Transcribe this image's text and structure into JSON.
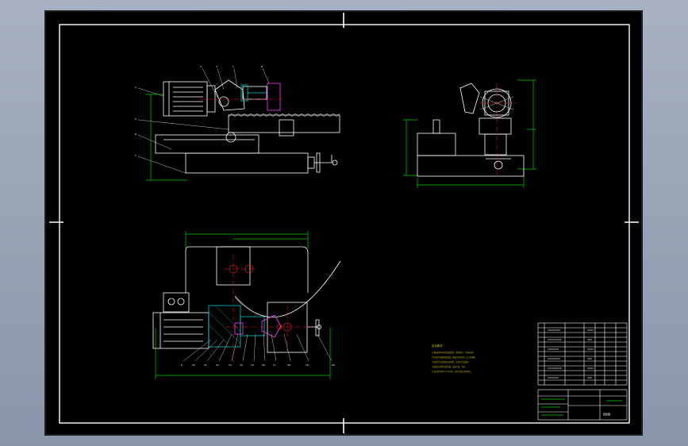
{
  "notes": {
    "title": "技术要求",
    "lines": [
      "1.装配前所有零件用煤油清洗，清除毛刺、飞边和杂物。",
      "2.各密封件装配前浸透油，装配后转动灵活，无卡滞现象。",
      "3.装配完毕后检查各运动部件，转动灵活无阻滞。",
      "4.装配后各零件位置正确，连接可靠、牢固。",
      "5.试运转时间不少于30分钟，运转平稳无异常声响。"
    ]
  },
  "title_block": {
    "drawing_name": "装配图"
  },
  "colors": {
    "border": "#ffffff",
    "dimension": "#00cc00",
    "outline": "#ffffff",
    "center": "#ff2020",
    "leader": "#cccccc",
    "section": "#00c8c8",
    "part": "#ff40ff",
    "note": "#bfbf00",
    "frame": "#000000",
    "viewport": "#98a3b6"
  }
}
